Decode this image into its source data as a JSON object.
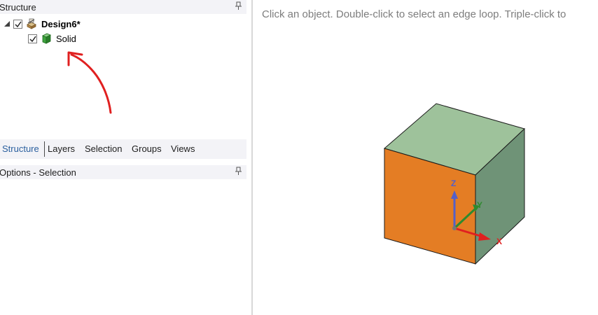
{
  "structure_panel": {
    "title": "Structure",
    "tree": {
      "root": {
        "label": "Design6*",
        "checked": true,
        "expanded": true,
        "icon": "design-icon"
      },
      "children": [
        {
          "label": "Solid",
          "checked": true,
          "icon": "solid-body-icon"
        }
      ]
    }
  },
  "tabs": [
    {
      "label": "Structure",
      "active": true
    },
    {
      "label": "Layers",
      "active": false
    },
    {
      "label": "Selection",
      "active": false
    },
    {
      "label": "Groups",
      "active": false
    },
    {
      "label": "Views",
      "active": false
    }
  ],
  "options_panel": {
    "title": "Options - Selection"
  },
  "viewport": {
    "hint": "Click an object. Double-click to select an edge loop. Triple-click to",
    "axes": {
      "z": "Z",
      "y": "Y",
      "x": "X"
    }
  },
  "colors": {
    "front_face": "#e47d24",
    "top_face": "#9ec29b",
    "side_face": "#6f9377",
    "annotation_arrow": "#e02020",
    "axis_z": "#5560c8",
    "axis_y": "#2e8a2e",
    "axis_x": "#e02020"
  }
}
